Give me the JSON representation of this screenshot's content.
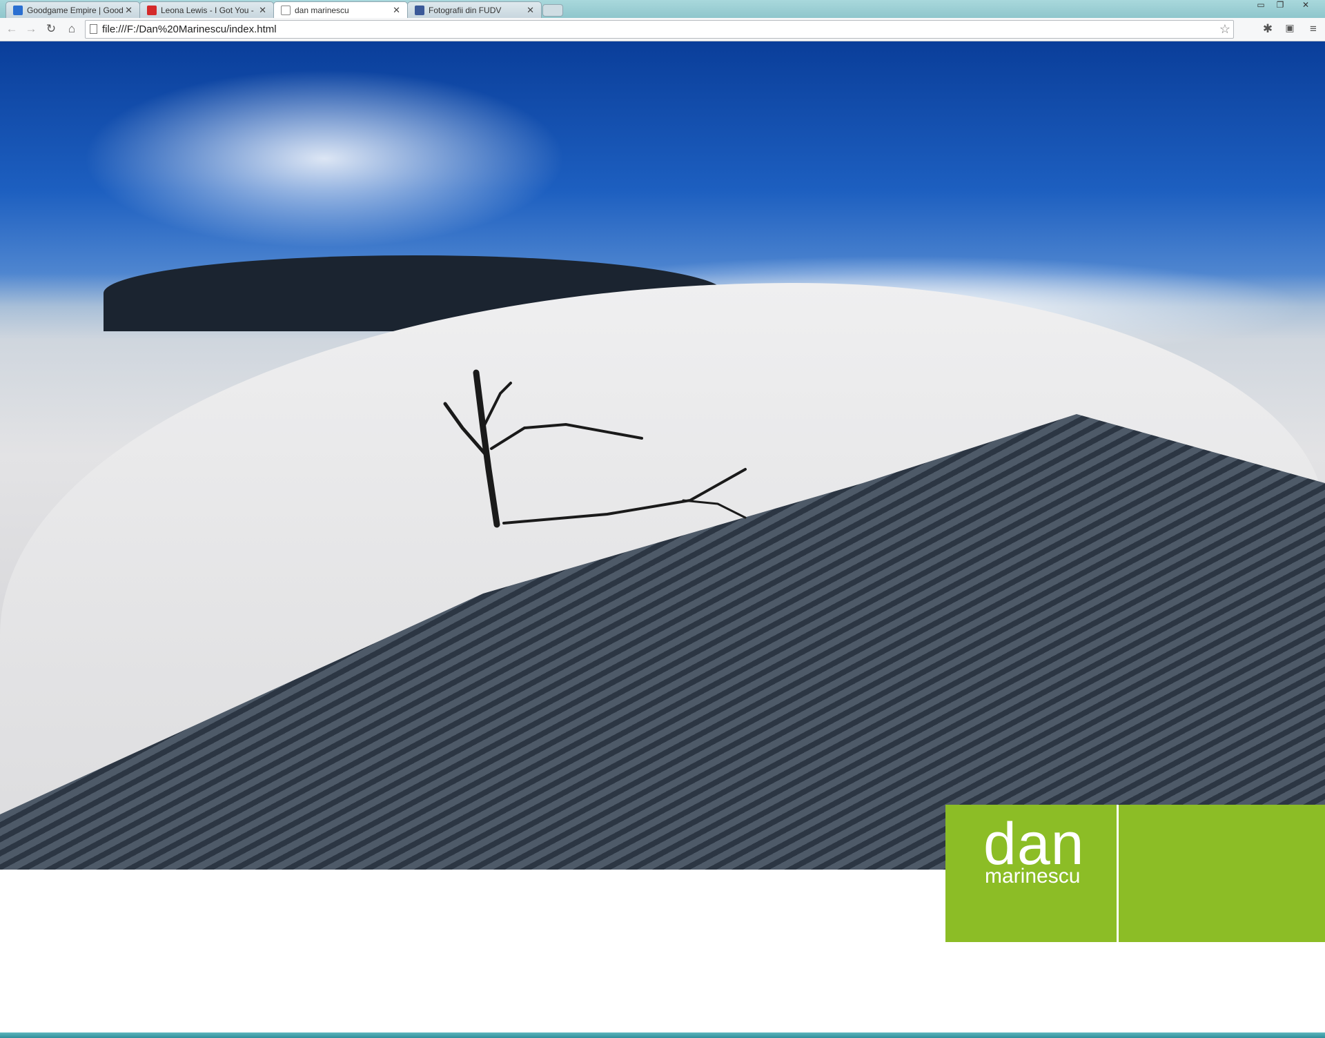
{
  "browser": {
    "tabs": [
      {
        "title": "Goodgame Empire | Good",
        "icon": "goodgame-icon",
        "color": "#2a6fd1",
        "active": false
      },
      {
        "title": "Leona Lewis - I Got You -",
        "icon": "youtube-icon",
        "color": "#d42a2a",
        "active": false
      },
      {
        "title": "dan marinescu",
        "icon": "page-icon",
        "color": "#ffffff",
        "active": true
      },
      {
        "title": "Fotografii din FUDV",
        "icon": "facebook-icon",
        "color": "#3b5998",
        "active": false
      }
    ],
    "url": "file:///F:/Dan%20Marinescu/index.html"
  },
  "page": {
    "brand_first": "dan",
    "brand_last": "marinescu",
    "brand_color": "#8cbd26"
  }
}
